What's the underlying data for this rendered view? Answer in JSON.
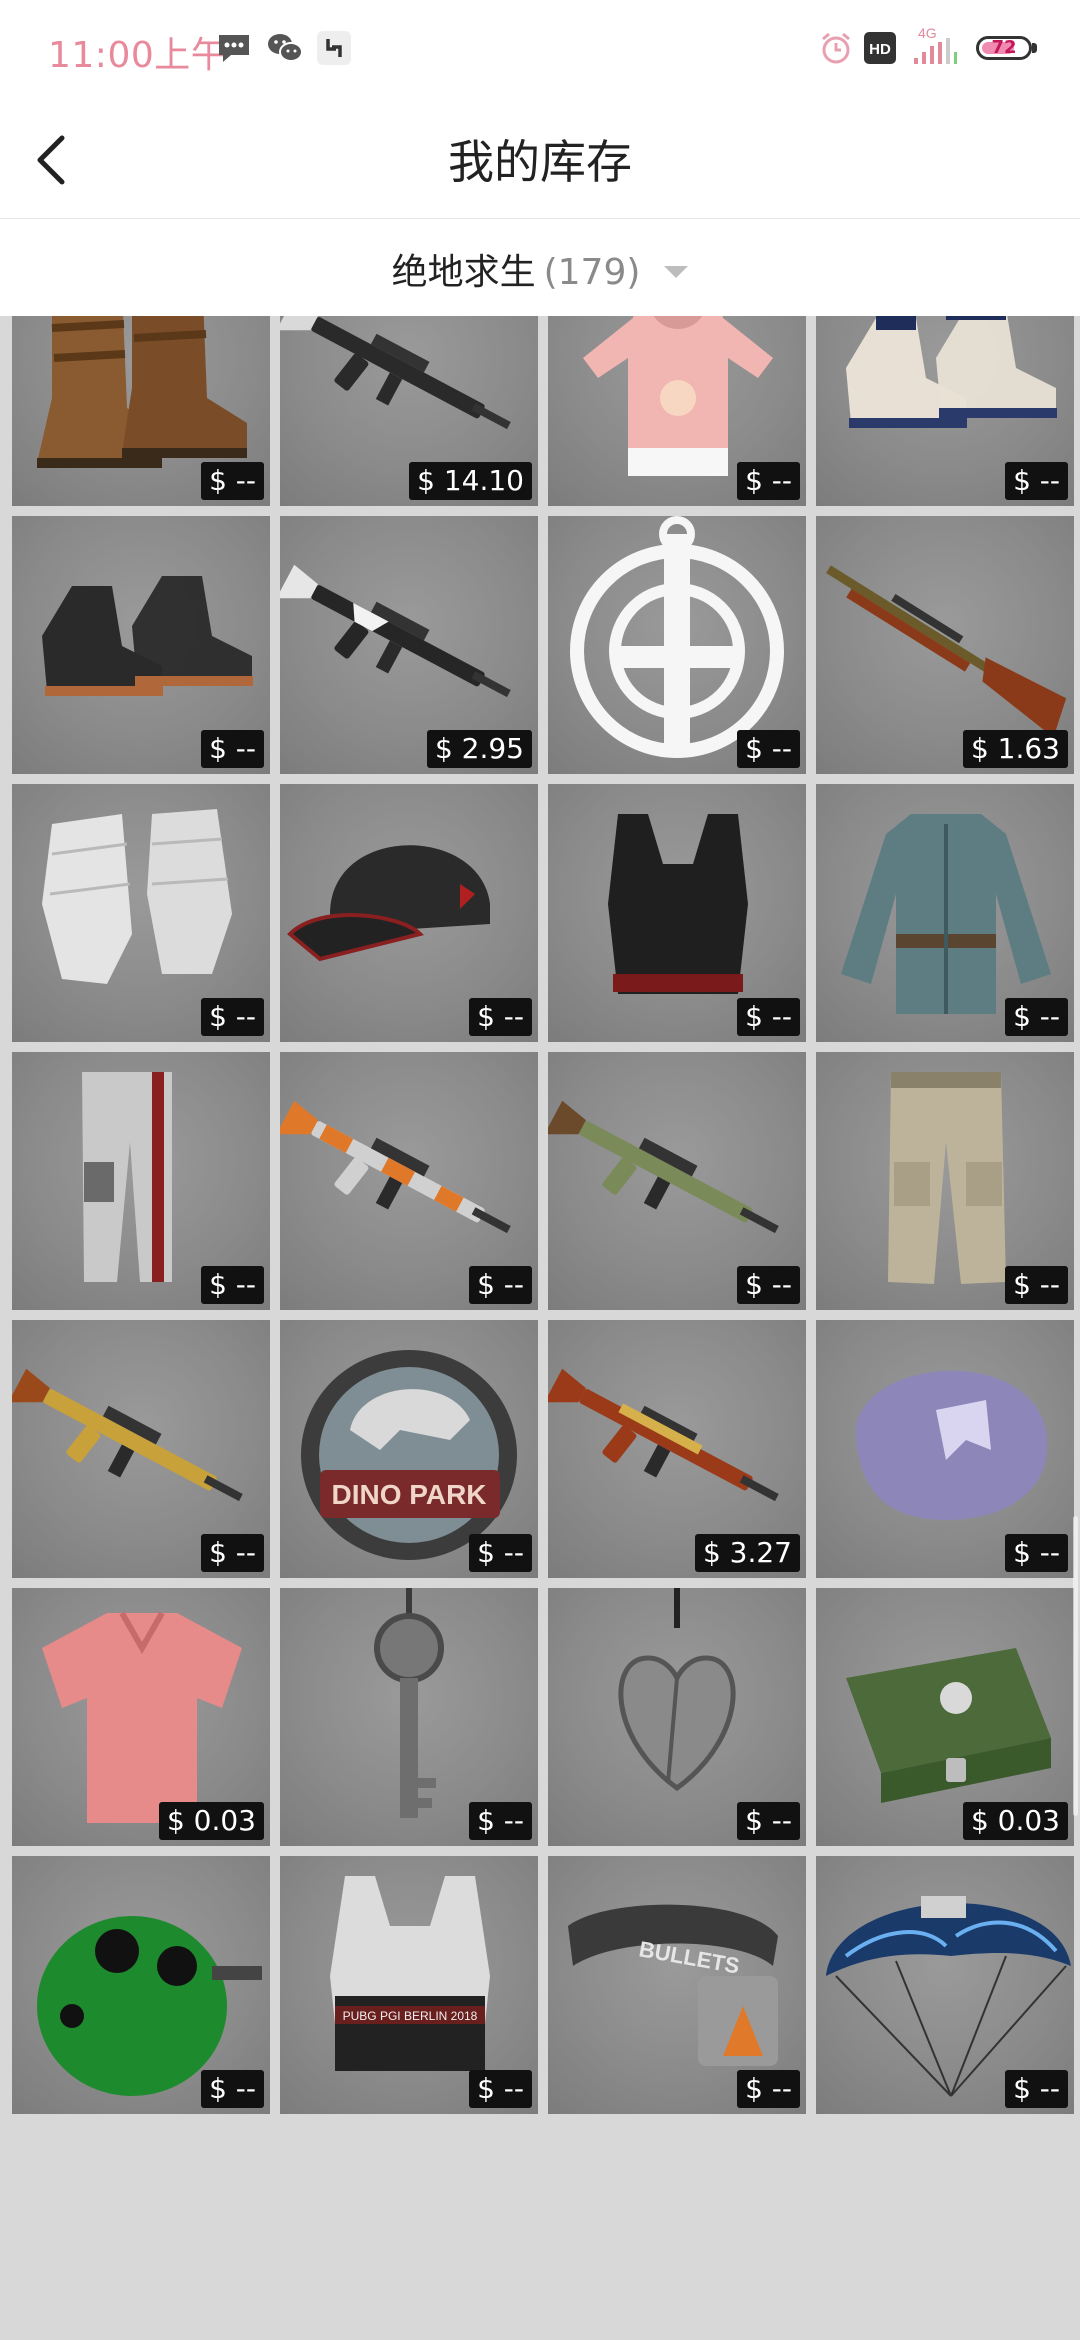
{
  "status_bar": {
    "time": "11:00上午",
    "network": "4G",
    "hd": "HD",
    "battery": "72",
    "battery_level": 0.72
  },
  "header": {
    "title": "我的库存",
    "back_icon": "back-arrow-icon"
  },
  "filter": {
    "game": "绝地求生",
    "count": "(179)"
  },
  "items": [
    {
      "icon": "splatter-pattern-icon",
      "price": "$ --"
    },
    {
      "icon": "feather-pattern-icon",
      "price": "$ --"
    },
    {
      "icon": "canvas-sneakers-icon",
      "price": "$ --"
    },
    {
      "icon": "grenade-icon",
      "price": "$ --"
    },
    {
      "icon": "leather-boots-icon",
      "price": "$ --"
    },
    {
      "icon": "assault-rifle-icon",
      "price": "$ 14.10"
    },
    {
      "icon": "bunny-hoodie-icon",
      "price": "$ --"
    },
    {
      "icon": "hiking-boots-icon",
      "price": "$ --"
    },
    {
      "icon": "combat-boots-icon",
      "price": "$ --"
    },
    {
      "icon": "submachine-gun-icon",
      "price": "$ 2.95"
    },
    {
      "icon": "sword-emblem-icon",
      "price": "$ --"
    },
    {
      "icon": "lever-rifle-icon",
      "price": "$ 1.63"
    },
    {
      "icon": "bandage-gloves-icon",
      "price": "$ --"
    },
    {
      "icon": "baseball-cap-icon",
      "price": "$ --"
    },
    {
      "icon": "sports-top-icon",
      "price": "$ --"
    },
    {
      "icon": "field-jacket-icon",
      "price": "$ --"
    },
    {
      "icon": "track-pants-icon",
      "price": "$ --"
    },
    {
      "icon": "camo-rifle-icon",
      "price": "$ --"
    },
    {
      "icon": "m16-rifle-icon",
      "price": "$ --"
    },
    {
      "icon": "cargo-pants-icon",
      "price": "$ --"
    },
    {
      "icon": "gold-rifle-icon",
      "price": "$ --"
    },
    {
      "icon": "dino-park-badge-icon",
      "price": "$ --"
    },
    {
      "icon": "gold-ak-rifle-icon",
      "price": "$ 3.27"
    },
    {
      "icon": "bandana-hat-icon",
      "price": "$ --"
    },
    {
      "icon": "polo-shirt-icon",
      "price": "$ 0.03"
    },
    {
      "icon": "key-charm-icon",
      "price": "$ --"
    },
    {
      "icon": "heart-charm-icon",
      "price": "$ --"
    },
    {
      "icon": "supply-crate-icon",
      "price": "$ 0.03"
    },
    {
      "icon": "crocodile-mask-icon",
      "price": "$ --"
    },
    {
      "icon": "berlin-top-icon",
      "price": "$ --"
    },
    {
      "icon": "bullets-belt-icon",
      "price": "$ --"
    },
    {
      "icon": "parachute-icon",
      "price": "$ --"
    }
  ],
  "art_text": {
    "dino": "DINO PARK",
    "bullets": "BULLETS",
    "berlin": "PUBG PGI BERLIN 2018"
  }
}
